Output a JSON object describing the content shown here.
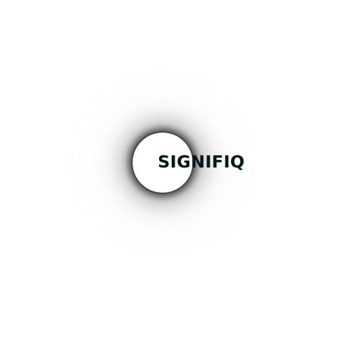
{
  "brand": {
    "name": "SIGNIFIQ"
  },
  "colors": {
    "background": "#ffffff",
    "text": "#0b1414",
    "glow": "#3a3a3a"
  }
}
